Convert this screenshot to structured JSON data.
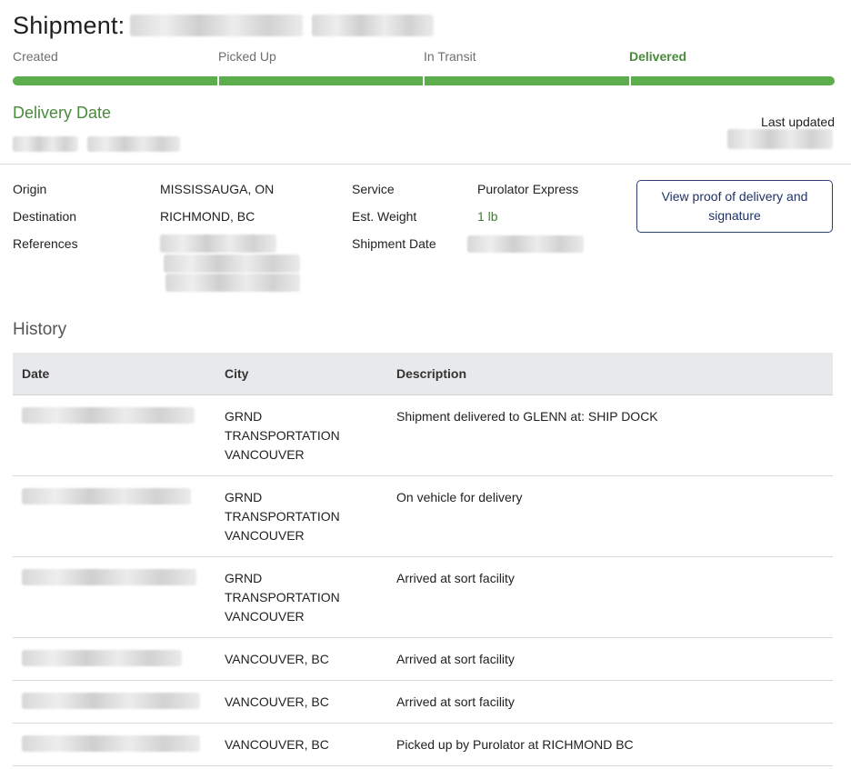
{
  "header": {
    "title_prefix": "Shipment:"
  },
  "progress": {
    "steps": [
      {
        "label": "Created",
        "active": false
      },
      {
        "label": "Picked Up",
        "active": false
      },
      {
        "label": "In Transit",
        "active": false
      },
      {
        "label": "Delivered",
        "active": true
      }
    ],
    "completed_segments": 4,
    "total_segments": 4,
    "color": "#5cad4c"
  },
  "delivery": {
    "heading": "Delivery Date",
    "last_updated_label": "Last updated"
  },
  "details": {
    "origin_label": "Origin",
    "origin_value": "MISSISSAUGA, ON",
    "destination_label": "Destination",
    "destination_value": "RICHMOND, BC",
    "references_label": "References",
    "service_label": "Service",
    "service_value": "Purolator Express",
    "weight_label": "Est. Weight",
    "weight_value": "1 lb",
    "shipment_date_label": "Shipment Date"
  },
  "pod_button": {
    "label": "View proof of delivery and signature"
  },
  "history": {
    "heading": "History",
    "columns": {
      "date": "Date",
      "city": "City",
      "description": "Description"
    },
    "rows": [
      {
        "city_lines": [
          "GRND",
          "TRANSPORTATION",
          "VANCOUVER"
        ],
        "description": "Shipment delivered to GLENN at: SHIP DOCK"
      },
      {
        "city_lines": [
          "GRND",
          "TRANSPORTATION",
          "VANCOUVER"
        ],
        "description": "On vehicle for delivery"
      },
      {
        "city_lines": [
          "GRND",
          "TRANSPORTATION",
          "VANCOUVER"
        ],
        "description": "Arrived at sort facility"
      },
      {
        "city_lines": [
          "VANCOUVER, BC"
        ],
        "description": "Arrived at sort facility"
      },
      {
        "city_lines": [
          "VANCOUVER, BC"
        ],
        "description": "Arrived at sort facility"
      },
      {
        "city_lines": [
          "VANCOUVER, BC"
        ],
        "description": "Picked up by Purolator at RICHMOND BC"
      }
    ]
  },
  "colors": {
    "accent_green": "#4a8a3c",
    "button_navy": "#1e3266"
  }
}
